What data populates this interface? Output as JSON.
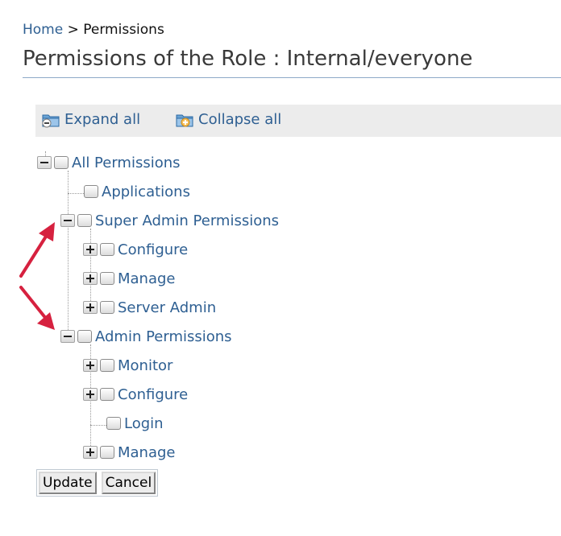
{
  "breadcrumb": {
    "home": "Home",
    "separator": ">",
    "current": "Permissions"
  },
  "page_title": "Permissions of the Role : Internal/everyone",
  "toolbar": {
    "expand_label": "Expand all",
    "expand_icon": "folder-expand-icon",
    "collapse_label": "Collapse all",
    "collapse_icon": "folder-collapse-icon"
  },
  "tree": {
    "all": "All Permissions",
    "applications": "Applications",
    "super_admin": "Super Admin Permissions",
    "sa_configure": "Configure",
    "sa_manage": "Manage",
    "sa_server_admin": "Server Admin",
    "admin": "Admin Permissions",
    "ad_monitor": "Monitor",
    "ad_configure": "Configure",
    "ad_login": "Login",
    "ad_manage": "Manage"
  },
  "buttons": {
    "update": "Update",
    "cancel": "Cancel"
  },
  "colors": {
    "link": "#2e5f92",
    "annotation_arrow": "#d6213f",
    "toolbar_bg": "#ececec"
  }
}
